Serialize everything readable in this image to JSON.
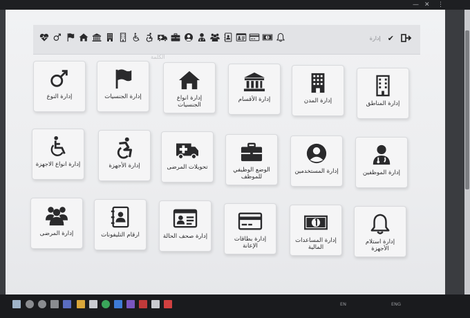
{
  "browser": {
    "window_controls": [
      "—",
      "✕",
      "⋮"
    ]
  },
  "quickbar_icons": [
    "heartbeat-icon",
    "gender-icon",
    "flag-icon",
    "home-icon",
    "bank-icon",
    "building-icon",
    "city-icon",
    "wheelchair-icon",
    "accessible-icon",
    "ambulance-icon",
    "briefcase-icon",
    "user-circle-icon",
    "user-doctor-icon",
    "users-icon",
    "address-book-icon",
    "id-card-icon",
    "credit-card-icon",
    "money-icon",
    "bell-icon"
  ],
  "header": {
    "section_label": "إدارة",
    "faint_label": "الكلمة"
  },
  "tiles": [
    {
      "label": "إدارة النوع",
      "icon": "gender-icon"
    },
    {
      "label": "إدارة الجنسيات",
      "icon": "flag-icon"
    },
    {
      "label": "إدارة انواع الجنسيات",
      "icon": "home-icon"
    },
    {
      "label": "إدارة الأقسام",
      "icon": "bank-icon"
    },
    {
      "label": "إدارة المدن",
      "icon": "building-icon"
    },
    {
      "label": "إدارة المناطق",
      "icon": "city-icon"
    },
    {
      "label": "إدارة انواع الاجهزة",
      "icon": "wheelchair-icon"
    },
    {
      "label": "إدارة الأجهزة",
      "icon": "accessible-icon"
    },
    {
      "label": "تحويلات المرضى",
      "icon": "ambulance-icon"
    },
    {
      "label": "الوضع الوظيفي للموظف",
      "icon": "briefcase-icon"
    },
    {
      "label": "إدارة المستخدمين",
      "icon": "user-circle-icon"
    },
    {
      "label": "إدارة الموظفين",
      "icon": "user-doctor-icon"
    },
    {
      "label": "إدارة المرضى",
      "icon": "users-icon"
    },
    {
      "label": "ارقام التليفونات",
      "icon": "address-book-icon"
    },
    {
      "label": "إدارة صحف الحالة",
      "icon": "id-card-icon"
    },
    {
      "label": "إدارة بطاقات الإعانة",
      "icon": "credit-card-icon"
    },
    {
      "label": "إدارة المساعدات المالية",
      "icon": "money-icon"
    },
    {
      "label": "إدارة استلام الأجهزة",
      "icon": "bell-icon"
    }
  ],
  "taskbar": {
    "tray_lang": "EN",
    "tray_text": "ENG"
  },
  "colors": {
    "screen_bg": "#eceef0",
    "tile_bg": "#f5f5f6",
    "icon": "#2a2a2c",
    "taskbar": "#1a1b1e"
  }
}
